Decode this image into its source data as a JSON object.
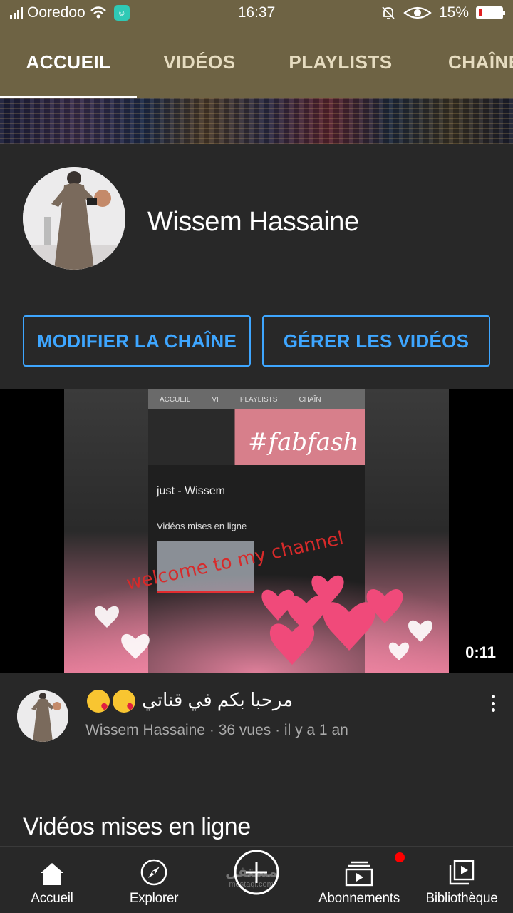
{
  "status_bar": {
    "carrier": "Ooredoo",
    "time": "16:37",
    "battery": "15%",
    "battery_level": 0.15
  },
  "tabs": [
    {
      "label": "ACCUEIL",
      "active": true
    },
    {
      "label": "VIDÉOS",
      "active": false
    },
    {
      "label": "PLAYLISTS",
      "active": false
    },
    {
      "label": "CHAÎNE",
      "active": false
    }
  ],
  "channel": {
    "name": "Wissem Hassaine",
    "edit_button": "MODIFIER LA CHAÎNE",
    "manage_button": "GÉRER LES VIDÉOS"
  },
  "featured_video": {
    "thumbnail": {
      "tabs": [
        "ACCUEIL",
        "VI",
        "PLAYLISTS",
        "CHAÎN"
      ],
      "banner_text": "#fabfash",
      "channel_name": "just - Wissem",
      "section": "Vidéos mises en ligne",
      "overlay_text": "welcome to my channel"
    },
    "duration": "0:11",
    "title": "مرحبا بكم في قناتي",
    "channel": "Wissem Hassaine",
    "meta": "Wissem Hassaine · 36 vues · il y a 1 an"
  },
  "uploads_section": {
    "title": "Vidéos mises en ligne"
  },
  "bottom_nav": [
    {
      "label": "Accueil",
      "icon": "home-icon"
    },
    {
      "label": "Explorer",
      "icon": "compass-icon"
    },
    {
      "label": "",
      "icon": "create-icon"
    },
    {
      "label": "Abonnements",
      "icon": "subscriptions-icon"
    },
    {
      "label": "Bibliothèque",
      "icon": "library-icon"
    }
  ],
  "watermark": {
    "line1": "مستقل",
    "line2": "mostaql.com"
  },
  "colors": {
    "header_bg": "#6e6344",
    "accent_blue": "#3ea6ff",
    "background": "#282828",
    "notification_dot": "#ff0000"
  }
}
